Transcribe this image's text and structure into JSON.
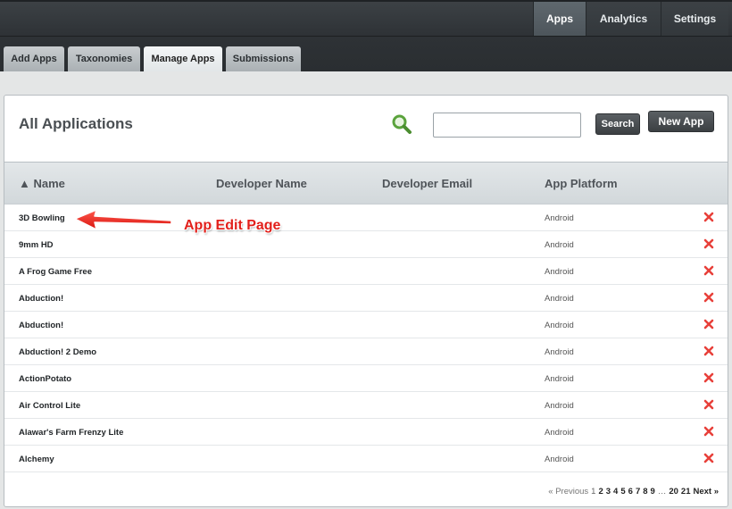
{
  "header": {
    "nav": [
      {
        "label": "Apps",
        "active": true
      },
      {
        "label": "Analytics",
        "active": false
      },
      {
        "label": "Settings",
        "active": false
      }
    ],
    "tabs": [
      {
        "label": "Add Apps",
        "active": false
      },
      {
        "label": "Taxonomies",
        "active": false
      },
      {
        "label": "Manage Apps",
        "active": true
      },
      {
        "label": "Submissions",
        "active": false
      }
    ]
  },
  "panel": {
    "title": "All Applications",
    "search": {
      "value": "",
      "placeholder": "",
      "button_label": "Search"
    },
    "new_app_label": "New App",
    "columns": [
      "▲ Name",
      "Developer Name",
      "Developer Email",
      "App Platform"
    ],
    "rows": [
      {
        "name": "3D Bowling",
        "developer_name": "",
        "developer_email": "",
        "platform": "Android"
      },
      {
        "name": "9mm HD",
        "developer_name": "",
        "developer_email": "",
        "platform": "Android"
      },
      {
        "name": "A Frog Game Free",
        "developer_name": "",
        "developer_email": "",
        "platform": "Android"
      },
      {
        "name": "Abduction!",
        "developer_name": "",
        "developer_email": "",
        "platform": "Android"
      },
      {
        "name": "Abduction!",
        "developer_name": "",
        "developer_email": "",
        "platform": "Android"
      },
      {
        "name": "Abduction! 2 Demo",
        "developer_name": "",
        "developer_email": "",
        "platform": "Android"
      },
      {
        "name": "ActionPotato",
        "developer_name": "",
        "developer_email": "",
        "platform": "Android"
      },
      {
        "name": "Air Control Lite",
        "developer_name": "",
        "developer_email": "",
        "platform": "Android"
      },
      {
        "name": "Alawar's Farm Frenzy Lite",
        "developer_name": "",
        "developer_email": "",
        "platform": "Android"
      },
      {
        "name": "Alchemy",
        "developer_name": "",
        "developer_email": "",
        "platform": "Android"
      }
    ],
    "annotation": "App Edit Page",
    "pagination": {
      "prev": "« Previous",
      "current": "1",
      "pages": [
        "2",
        "3",
        "4",
        "5",
        "6",
        "7",
        "8",
        "9"
      ],
      "ellipsis": "…",
      "tail_pages": [
        "20",
        "21"
      ],
      "next": "Next »"
    }
  },
  "colors": {
    "delete_icon": "#e8403a",
    "search_icon": "#5aa33c",
    "annotation": "#e2201b"
  },
  "icons": {
    "search": "magnifier-icon",
    "delete": "close-x-icon",
    "arrow": "left-arrow-icon"
  }
}
